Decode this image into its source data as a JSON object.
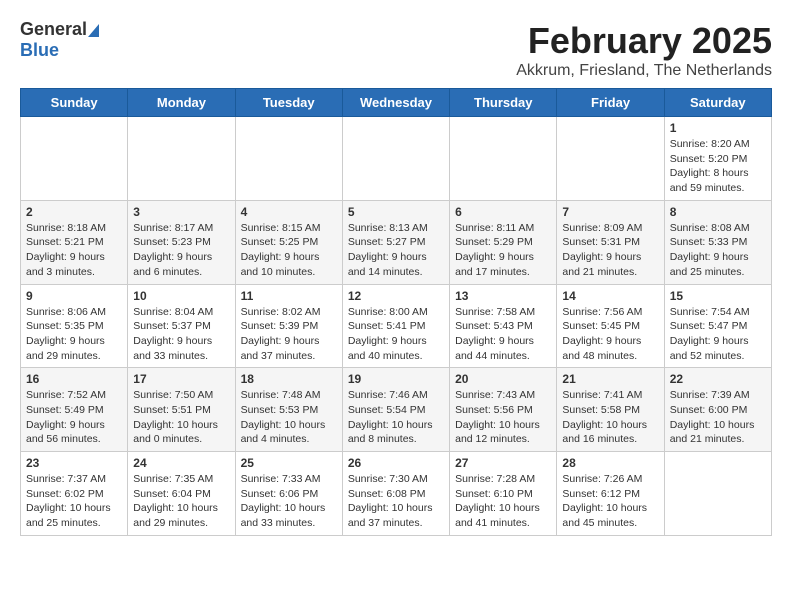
{
  "logo": {
    "line1": "General",
    "line2": "Blue"
  },
  "header": {
    "title": "February 2025",
    "subtitle": "Akkrum, Friesland, The Netherlands"
  },
  "weekdays": [
    "Sunday",
    "Monday",
    "Tuesday",
    "Wednesday",
    "Thursday",
    "Friday",
    "Saturday"
  ],
  "weeks": [
    [
      {
        "day": "",
        "info": ""
      },
      {
        "day": "",
        "info": ""
      },
      {
        "day": "",
        "info": ""
      },
      {
        "day": "",
        "info": ""
      },
      {
        "day": "",
        "info": ""
      },
      {
        "day": "",
        "info": ""
      },
      {
        "day": "1",
        "info": "Sunrise: 8:20 AM\nSunset: 5:20 PM\nDaylight: 8 hours and 59 minutes."
      }
    ],
    [
      {
        "day": "2",
        "info": "Sunrise: 8:18 AM\nSunset: 5:21 PM\nDaylight: 9 hours and 3 minutes."
      },
      {
        "day": "3",
        "info": "Sunrise: 8:17 AM\nSunset: 5:23 PM\nDaylight: 9 hours and 6 minutes."
      },
      {
        "day": "4",
        "info": "Sunrise: 8:15 AM\nSunset: 5:25 PM\nDaylight: 9 hours and 10 minutes."
      },
      {
        "day": "5",
        "info": "Sunrise: 8:13 AM\nSunset: 5:27 PM\nDaylight: 9 hours and 14 minutes."
      },
      {
        "day": "6",
        "info": "Sunrise: 8:11 AM\nSunset: 5:29 PM\nDaylight: 9 hours and 17 minutes."
      },
      {
        "day": "7",
        "info": "Sunrise: 8:09 AM\nSunset: 5:31 PM\nDaylight: 9 hours and 21 minutes."
      },
      {
        "day": "8",
        "info": "Sunrise: 8:08 AM\nSunset: 5:33 PM\nDaylight: 9 hours and 25 minutes."
      }
    ],
    [
      {
        "day": "9",
        "info": "Sunrise: 8:06 AM\nSunset: 5:35 PM\nDaylight: 9 hours and 29 minutes."
      },
      {
        "day": "10",
        "info": "Sunrise: 8:04 AM\nSunset: 5:37 PM\nDaylight: 9 hours and 33 minutes."
      },
      {
        "day": "11",
        "info": "Sunrise: 8:02 AM\nSunset: 5:39 PM\nDaylight: 9 hours and 37 minutes."
      },
      {
        "day": "12",
        "info": "Sunrise: 8:00 AM\nSunset: 5:41 PM\nDaylight: 9 hours and 40 minutes."
      },
      {
        "day": "13",
        "info": "Sunrise: 7:58 AM\nSunset: 5:43 PM\nDaylight: 9 hours and 44 minutes."
      },
      {
        "day": "14",
        "info": "Sunrise: 7:56 AM\nSunset: 5:45 PM\nDaylight: 9 hours and 48 minutes."
      },
      {
        "day": "15",
        "info": "Sunrise: 7:54 AM\nSunset: 5:47 PM\nDaylight: 9 hours and 52 minutes."
      }
    ],
    [
      {
        "day": "16",
        "info": "Sunrise: 7:52 AM\nSunset: 5:49 PM\nDaylight: 9 hours and 56 minutes."
      },
      {
        "day": "17",
        "info": "Sunrise: 7:50 AM\nSunset: 5:51 PM\nDaylight: 10 hours and 0 minutes."
      },
      {
        "day": "18",
        "info": "Sunrise: 7:48 AM\nSunset: 5:53 PM\nDaylight: 10 hours and 4 minutes."
      },
      {
        "day": "19",
        "info": "Sunrise: 7:46 AM\nSunset: 5:54 PM\nDaylight: 10 hours and 8 minutes."
      },
      {
        "day": "20",
        "info": "Sunrise: 7:43 AM\nSunset: 5:56 PM\nDaylight: 10 hours and 12 minutes."
      },
      {
        "day": "21",
        "info": "Sunrise: 7:41 AM\nSunset: 5:58 PM\nDaylight: 10 hours and 16 minutes."
      },
      {
        "day": "22",
        "info": "Sunrise: 7:39 AM\nSunset: 6:00 PM\nDaylight: 10 hours and 21 minutes."
      }
    ],
    [
      {
        "day": "23",
        "info": "Sunrise: 7:37 AM\nSunset: 6:02 PM\nDaylight: 10 hours and 25 minutes."
      },
      {
        "day": "24",
        "info": "Sunrise: 7:35 AM\nSunset: 6:04 PM\nDaylight: 10 hours and 29 minutes."
      },
      {
        "day": "25",
        "info": "Sunrise: 7:33 AM\nSunset: 6:06 PM\nDaylight: 10 hours and 33 minutes."
      },
      {
        "day": "26",
        "info": "Sunrise: 7:30 AM\nSunset: 6:08 PM\nDaylight: 10 hours and 37 minutes."
      },
      {
        "day": "27",
        "info": "Sunrise: 7:28 AM\nSunset: 6:10 PM\nDaylight: 10 hours and 41 minutes."
      },
      {
        "day": "28",
        "info": "Sunrise: 7:26 AM\nSunset: 6:12 PM\nDaylight: 10 hours and 45 minutes."
      },
      {
        "day": "",
        "info": ""
      }
    ]
  ]
}
